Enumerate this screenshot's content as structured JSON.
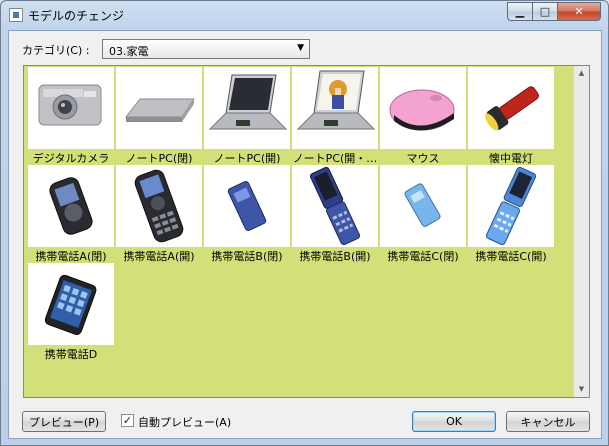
{
  "window": {
    "title": "モデルのチェンジ"
  },
  "category": {
    "label": "カテゴリ(C) :",
    "selected": "03.家電"
  },
  "items": [
    {
      "label": "デジタルカメラ",
      "icon": "digital-camera-icon"
    },
    {
      "label": "ノートPC(閉)",
      "icon": "laptop-closed-icon"
    },
    {
      "label": "ノートPC(開)",
      "icon": "laptop-open-icon"
    },
    {
      "label": "ノートPC(開・…",
      "icon": "laptop-open-wallpaper-icon"
    },
    {
      "label": "マウス",
      "icon": "mouse-icon"
    },
    {
      "label": "懐中電灯",
      "icon": "flashlight-icon"
    },
    {
      "label": "携帯電話A(閉)",
      "icon": "phone-a-closed-icon"
    },
    {
      "label": "携帯電話A(開)",
      "icon": "phone-a-open-icon"
    },
    {
      "label": "携帯電話B(閉)",
      "icon": "phone-b-closed-icon"
    },
    {
      "label": "携帯電話B(開)",
      "icon": "phone-b-open-icon"
    },
    {
      "label": "携帯電話C(閉)",
      "icon": "phone-c-closed-icon"
    },
    {
      "label": "携帯電話C(開)",
      "icon": "phone-c-open-icon"
    },
    {
      "label": "携帯電話D",
      "icon": "smartphone-icon"
    }
  ],
  "buttons": {
    "preview": "プレビュー(P)",
    "ok": "OK",
    "cancel": "キャンセル"
  },
  "auto_preview": {
    "label": "自動プレビュー(A)",
    "checked": true
  },
  "colors": {
    "grid_background": "#d3e07a",
    "title_bar": "#c4d6ee"
  }
}
